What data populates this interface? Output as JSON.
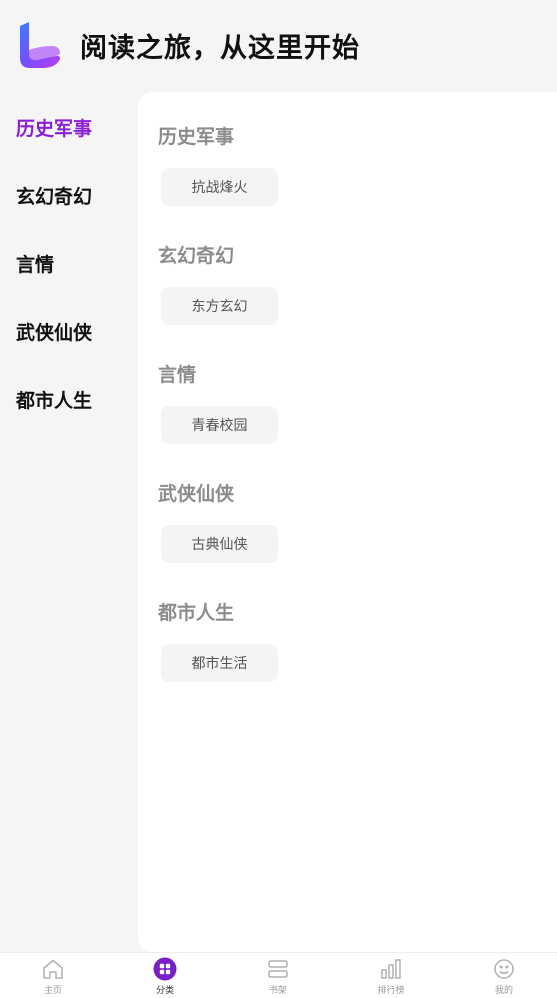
{
  "header": {
    "title": "阅读之旅，从这里开始"
  },
  "colors": {
    "accent": "#8a1fd6",
    "muted_title": "#8c8c8c"
  },
  "sidebar": {
    "items": [
      {
        "label": "历史军事",
        "active": true
      },
      {
        "label": "玄幻奇幻",
        "active": false
      },
      {
        "label": "言情",
        "active": false
      },
      {
        "label": "武侠仙侠",
        "active": false
      },
      {
        "label": "都市人生",
        "active": false
      }
    ]
  },
  "sections": [
    {
      "title": "历史军事",
      "tags": [
        "抗战烽火"
      ]
    },
    {
      "title": "玄幻奇幻",
      "tags": [
        "东方玄幻"
      ]
    },
    {
      "title": "言情",
      "tags": [
        "青春校园"
      ]
    },
    {
      "title": "武侠仙侠",
      "tags": [
        "古典仙侠"
      ]
    },
    {
      "title": "都市人生",
      "tags": [
        "都市生活"
      ]
    }
  ],
  "tabbar": {
    "tabs": [
      {
        "label": "主页",
        "icon": "home-icon",
        "active": false
      },
      {
        "label": "分类",
        "icon": "category-icon",
        "active": true
      },
      {
        "label": "书架",
        "icon": "bookshelf-icon",
        "active": false
      },
      {
        "label": "排行榜",
        "icon": "ranking-icon",
        "active": false
      },
      {
        "label": "我的",
        "icon": "profile-icon",
        "active": false
      }
    ]
  }
}
